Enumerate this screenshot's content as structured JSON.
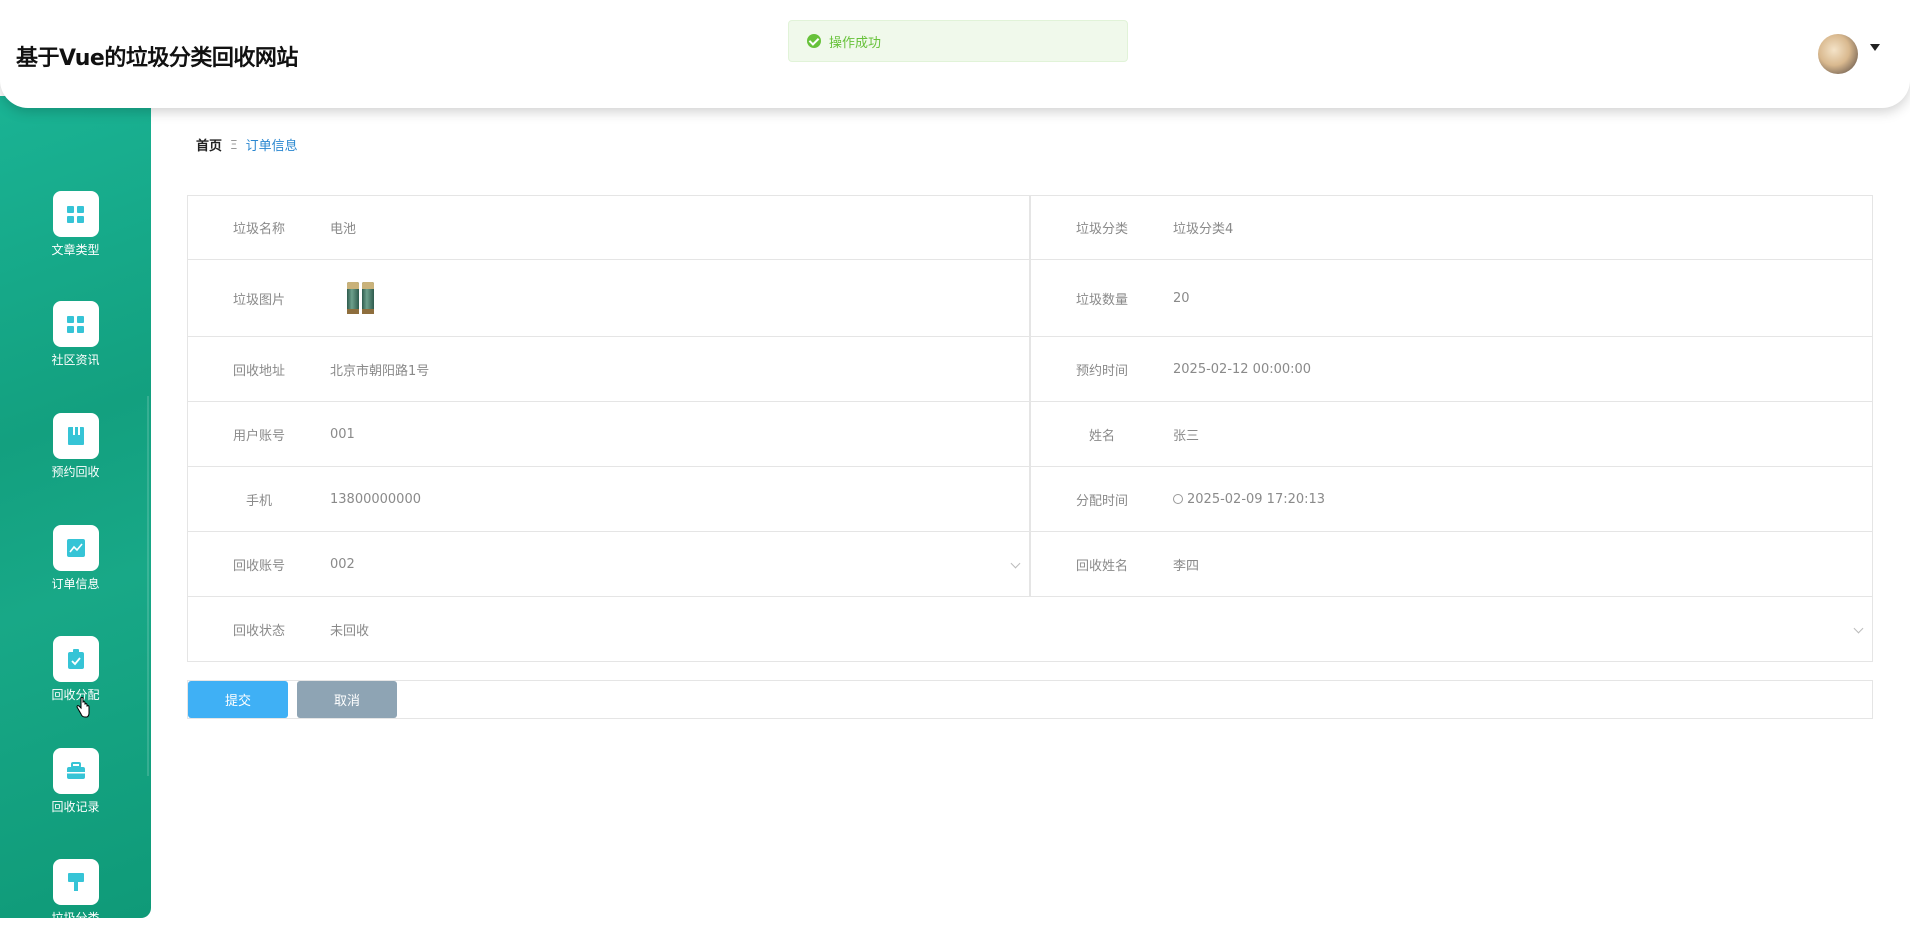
{
  "header": {
    "site_title": "基于Vue的垃圾分类回收网站"
  },
  "toast": {
    "message": "操作成功",
    "color": "#67c23a"
  },
  "sidebar": {
    "items": [
      {
        "label": "文章类型",
        "icon": "grid-icon"
      },
      {
        "label": "社区资讯",
        "icon": "grid-icon"
      },
      {
        "label": "预约回收",
        "icon": "book-icon"
      },
      {
        "label": "订单信息",
        "icon": "chart-icon"
      },
      {
        "label": "回收分配",
        "icon": "clipboard-check-icon"
      },
      {
        "label": "回收记录",
        "icon": "briefcase-icon"
      },
      {
        "label": "垃圾分类",
        "icon": "brush-icon"
      }
    ]
  },
  "breadcrumb": {
    "home": "首页",
    "separator": "Ξ",
    "current": "订单信息"
  },
  "form": {
    "garbage_name": {
      "label": "垃圾名称",
      "value": "电池"
    },
    "garbage_category": {
      "label": "垃圾分类",
      "value": "垃圾分类4"
    },
    "garbage_image": {
      "label": "垃圾图片"
    },
    "garbage_quantity": {
      "label": "垃圾数量",
      "value": "20"
    },
    "recycle_address": {
      "label": "回收地址",
      "value": "北京市朝阳路1号"
    },
    "appointment_time": {
      "label": "预约时间",
      "value": "2025-02-12 00:00:00"
    },
    "user_account": {
      "label": "用户账号",
      "value": "001"
    },
    "name": {
      "label": "姓名",
      "value": "张三"
    },
    "phone": {
      "label": "手机",
      "value": "13800000000"
    },
    "assign_time": {
      "label": "分配时间",
      "value": "2025-02-09 17:20:13"
    },
    "recycler_account": {
      "label": "回收账号",
      "value": "002"
    },
    "recycler_name": {
      "label": "回收姓名",
      "value": "李四"
    },
    "recycle_status": {
      "label": "回收状态",
      "value": "未回收"
    }
  },
  "buttons": {
    "submit": "提交",
    "cancel": "取消"
  },
  "colors": {
    "sidebar": "#13a07f",
    "submit": "#3fb0f5",
    "cancel": "#8ea4b4",
    "breadcrumb_current": "#2a87d0"
  }
}
